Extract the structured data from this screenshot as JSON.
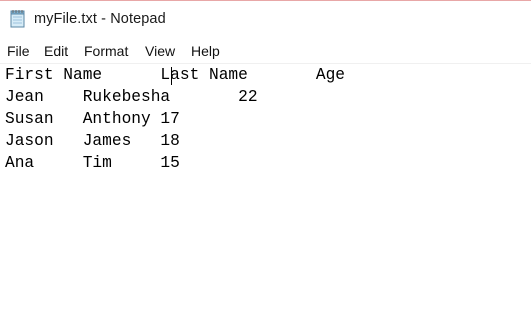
{
  "window": {
    "title": "myFile.txt - Notepad",
    "icon": "notepad-icon",
    "accent_color": "#e8a7a7"
  },
  "menu": {
    "file": "File",
    "edit": "Edit",
    "format": "Format",
    "view": "View",
    "help": "Help"
  },
  "document": {
    "lines": [
      "First Name      Last Name       Age",
      "Jean    Rukebesha       22",
      "Susan   Anthony 17",
      "Jason   James   18",
      "Ana     Tim     15"
    ]
  }
}
